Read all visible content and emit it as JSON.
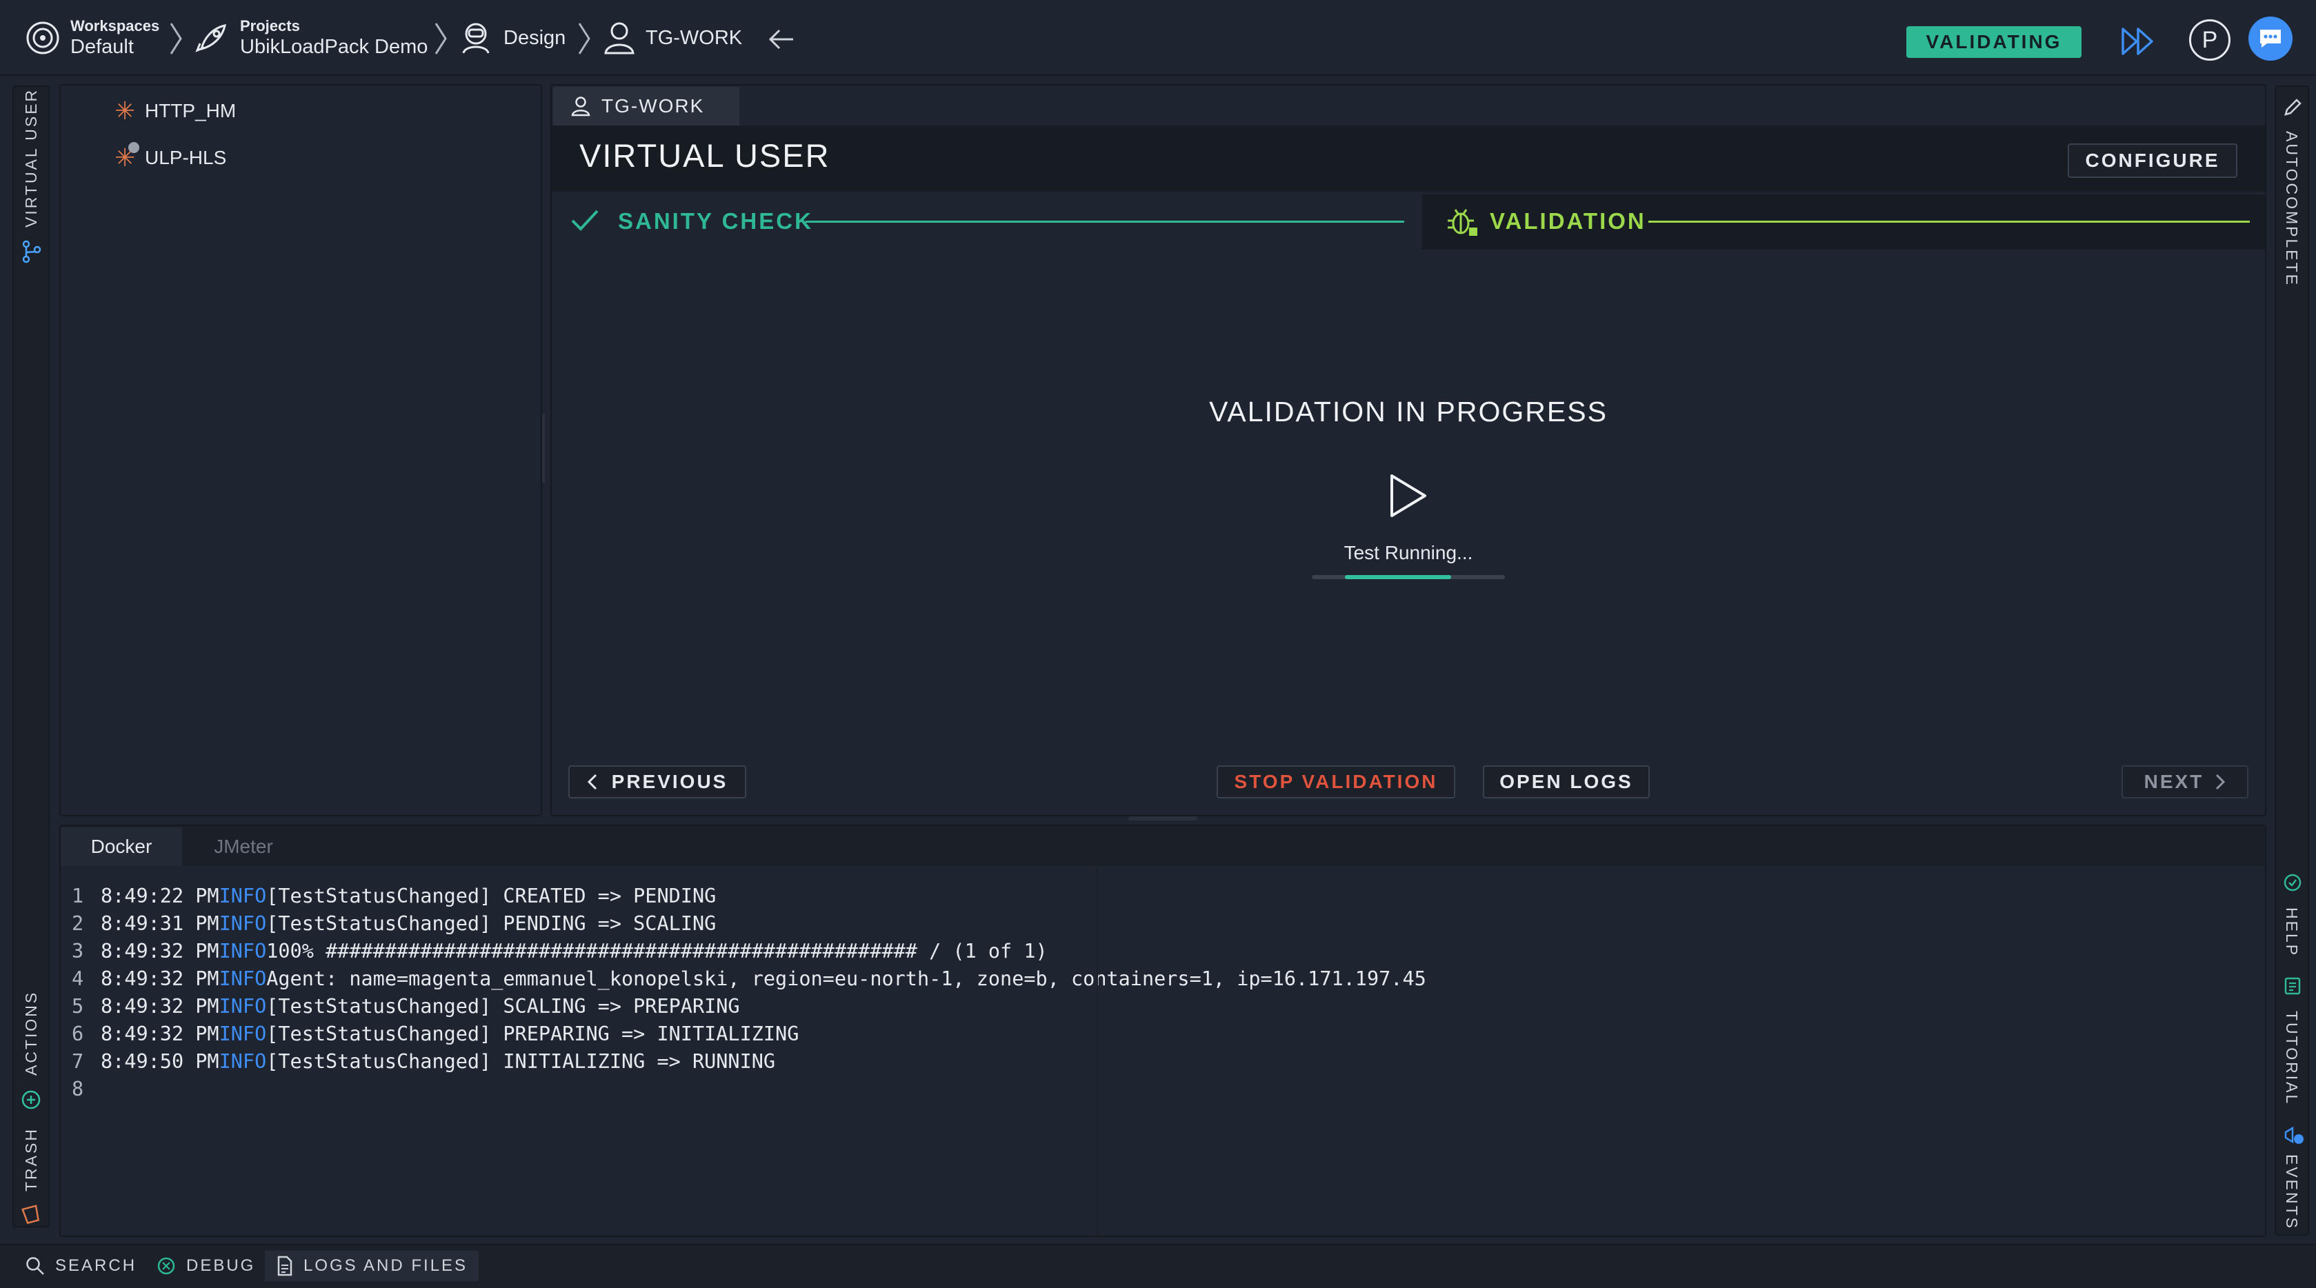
{
  "breadcrumb": {
    "workspaces": {
      "label": "Workspaces",
      "value": "Default"
    },
    "projects": {
      "label": "Projects",
      "value": "UbikLoadPack Demo"
    },
    "design": "Design",
    "test": "TG-WORK"
  },
  "header": {
    "status_badge": "VALIDATING",
    "avatar_letter": "P"
  },
  "left_rail": {
    "virtual_user": "VIRTUAL USER",
    "actions": "ACTIONS",
    "trash": "TRASH"
  },
  "tree": {
    "items": [
      {
        "label": "HTTP_HM"
      },
      {
        "label": "ULP-HLS"
      }
    ]
  },
  "main": {
    "tab_label": "TG-WORK",
    "title": "VIRTUAL USER",
    "configure_label": "CONFIGURE",
    "steps": [
      {
        "label": "SANITY CHECK",
        "state": "done"
      },
      {
        "label": "VALIDATION",
        "state": "active"
      }
    ],
    "progress_title": "VALIDATION IN PROGRESS",
    "running_text": "Test Running...",
    "progress_fraction": 0.55,
    "buttons": {
      "previous": "PREVIOUS",
      "stop": "STOP VALIDATION",
      "open_logs": "OPEN LOGS",
      "next": "NEXT"
    }
  },
  "logs": {
    "tabs": [
      "Docker",
      "JMeter"
    ],
    "active_tab": "Docker",
    "lines": [
      {
        "n": "1",
        "time": "8:49:22 PM",
        "level": "INFO",
        "msg": "[TestStatusChanged] CREATED => PENDING"
      },
      {
        "n": "2",
        "time": "8:49:31 PM",
        "level": "INFO",
        "msg": "[TestStatusChanged] PENDING => SCALING"
      },
      {
        "n": "3",
        "time": "8:49:32 PM",
        "level": "INFO",
        "msg": "100% ################################################## / (1 of 1)"
      },
      {
        "n": "4",
        "time": "8:49:32 PM",
        "level": "INFO",
        "msg": "Agent: name=magenta_emmanuel_konopelski, region=eu-north-1, zone=b, containers=1, ip=16.171.197.45"
      },
      {
        "n": "5",
        "time": "8:49:32 PM",
        "level": "INFO",
        "msg": "[TestStatusChanged] SCALING => PREPARING"
      },
      {
        "n": "6",
        "time": "8:49:32 PM",
        "level": "INFO",
        "msg": "[TestStatusChanged] PREPARING => INITIALIZING"
      },
      {
        "n": "7",
        "time": "8:49:50 PM",
        "level": "INFO",
        "msg": "[TestStatusChanged] INITIALIZING => RUNNING"
      },
      {
        "n": "8",
        "time": "",
        "level": "",
        "msg": ""
      }
    ]
  },
  "right_rail": {
    "autocomplete": "AUTOCOMPLETE",
    "help": "HELP",
    "tutorial": "TUTORIAL",
    "events": "EVENTS"
  },
  "bottom_bar": {
    "search": "SEARCH",
    "debug": "DEBUG",
    "logs_and_files": "LOGS AND FILES"
  },
  "colors": {
    "accent": "#2fb894",
    "validation_green": "#9bd84a",
    "stop_red": "#e0533c",
    "info_blue": "#3d8ef5",
    "tree_star": "#e0794a"
  }
}
